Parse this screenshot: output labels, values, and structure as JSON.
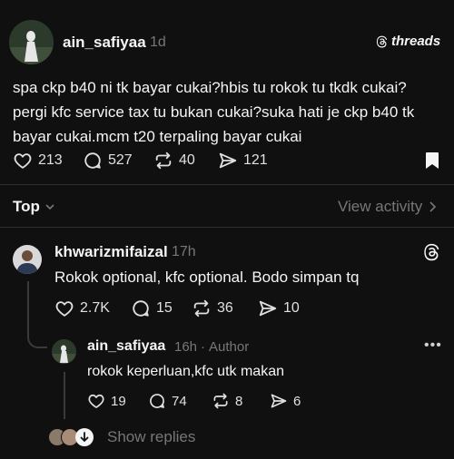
{
  "post": {
    "author": "ain_safiyaa",
    "time": "1d",
    "brand": "threads",
    "text": "spa ckp b40 ni tk bayar cukai?hbis tu rokok tu tkdk cukai? pergi kfc service tax tu bukan cukai?suka hati je ckp b40 tk bayar cukai.mcm t20 terpaling bayar cukai",
    "likes": "213",
    "replies": "527",
    "reposts": "40",
    "shares": "121"
  },
  "sort": {
    "label": "Top",
    "view_activity": "View activity"
  },
  "reply1": {
    "author": "khwarizmifaizal",
    "time": "17h",
    "text": "Rokok optional, kfc optional. Bodo simpan tq",
    "likes": "2.7K",
    "replies": "15",
    "reposts": "36",
    "shares": "10"
  },
  "reply2": {
    "author": "ain_safiyaa",
    "time": "16h",
    "author_tag": "Author",
    "separator": "·",
    "text": "rokok keperluan,kfc utk makan",
    "likes": "19",
    "replies": "74",
    "reposts": "8",
    "shares": "6"
  },
  "show_replies": "Show replies",
  "colors": {
    "background": "#101010",
    "text": "#f3f5f7",
    "muted": "#777777"
  }
}
